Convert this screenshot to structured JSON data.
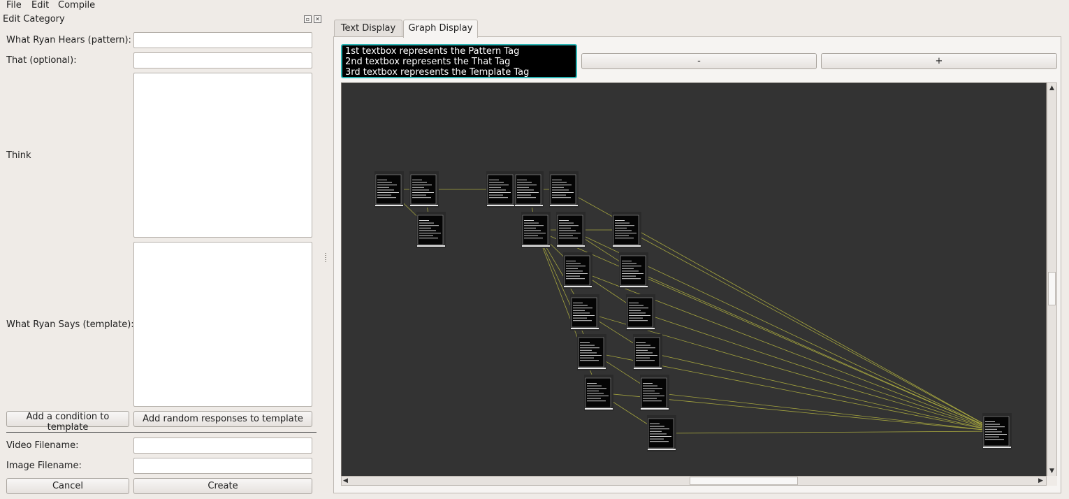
{
  "menu": {
    "file": "File",
    "edit": "Edit",
    "compile": "Compile"
  },
  "dock": {
    "title": "Edit Category",
    "pattern_label": "What Ryan Hears (pattern):",
    "pattern_value": "",
    "that_label": "That (optional):",
    "that_value": "",
    "think_label": "Think",
    "think_value": "",
    "template_label": "What Ryan Says (template):",
    "template_value": "",
    "add_condition_label": "Add a condition to template",
    "add_random_label": "Add random responses to template",
    "video_label": "Video Filename:",
    "video_value": "",
    "image_label": "Image Filename:",
    "image_value": "",
    "cancel_label": "Cancel",
    "create_label": "Create"
  },
  "tabs": {
    "text_display": "Text Display",
    "graph_display": "Graph Display",
    "active": "Graph Display"
  },
  "graph": {
    "info_text": "1st textbox represents the Pattern Tag\n2nd textbox represents the That Tag\n3rd textbox represents the Template Tag",
    "minus_label": "-",
    "plus_label": "+",
    "canvas_bg": "#333333",
    "node_count": 24,
    "edge_color": "#b8b840"
  },
  "colors": {
    "window_bg": "#efebe7",
    "info_border": "#2bb5b5"
  }
}
